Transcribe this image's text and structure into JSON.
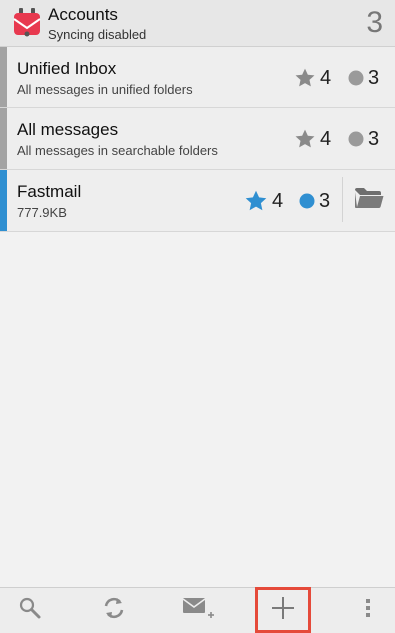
{
  "header": {
    "title": "Accounts",
    "subtitle": "Syncing disabled",
    "count": "3"
  },
  "accounts": [
    {
      "title": "Unified Inbox",
      "subtitle": "All messages in unified folders",
      "starred": "4",
      "unread": "3"
    },
    {
      "title": "All messages",
      "subtitle": "All messages in searchable folders",
      "starred": "4",
      "unread": "3"
    },
    {
      "title": "Fastmail",
      "subtitle": "777.9KB",
      "starred": "4",
      "unread": "3"
    }
  ],
  "toolbar": {
    "icons": [
      "search-icon",
      "refresh-icon",
      "compose-icon",
      "add-icon",
      "overflow-menu-icon"
    ]
  },
  "colors": {
    "accent_blue": "#2f8fd1",
    "grey_indicator": "#a3a3a3",
    "highlight_red": "#e54a3a",
    "app_icon_red": "#e8394f"
  }
}
